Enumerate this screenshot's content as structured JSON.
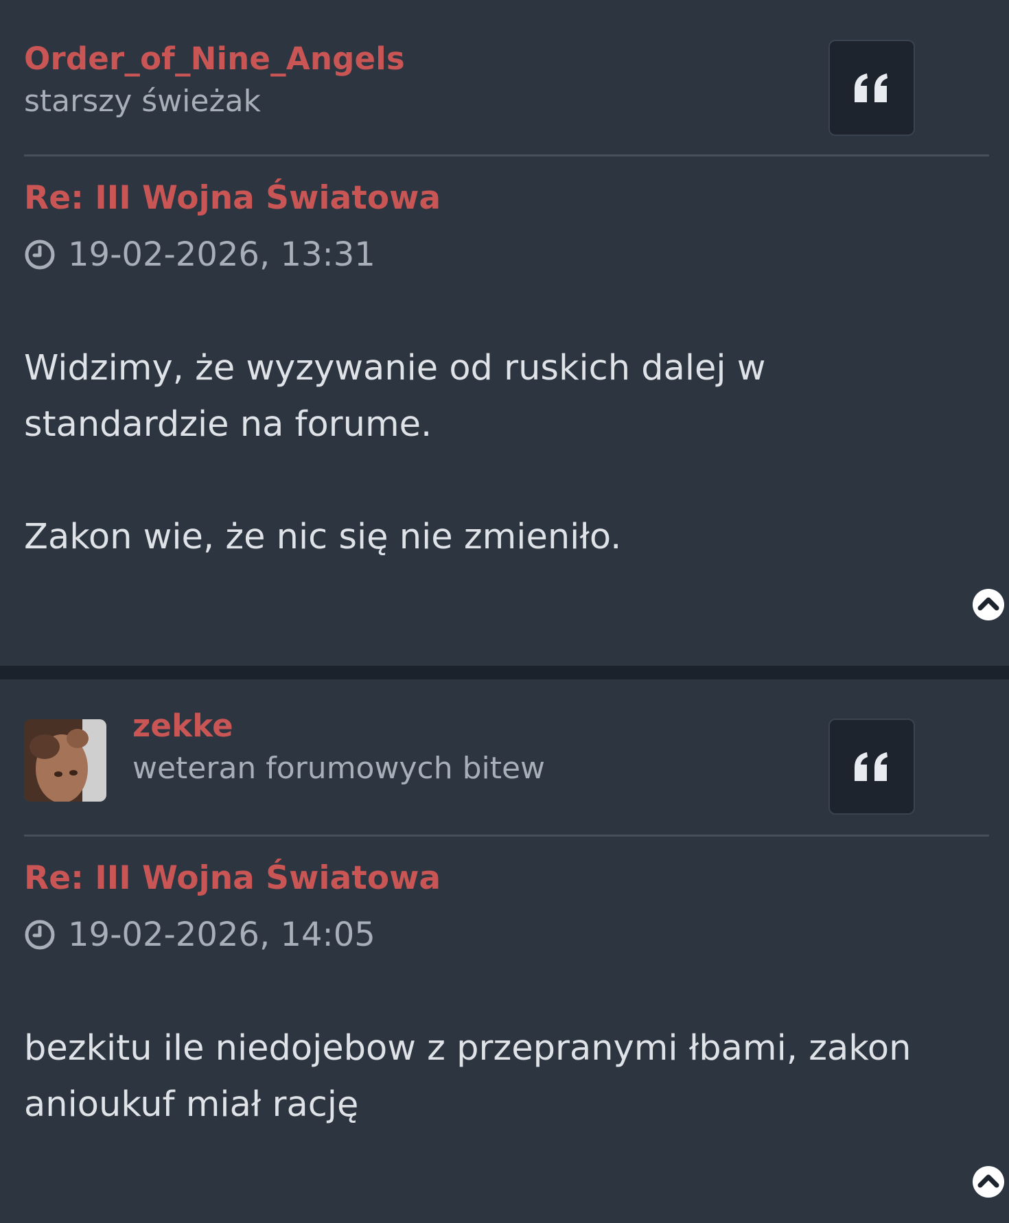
{
  "posts": [
    {
      "author": "Order_of_Nine_Angels",
      "rank": "starszy świeżak",
      "title": "Re: III Wojna Światowa",
      "time": "19-02-2026, 13:31",
      "body": [
        "Widzimy, że wyzywanie od ruskich dalej w standardzie na forume.",
        "Zakon wie, że nic się nie zmieniło."
      ]
    },
    {
      "author": "zekke",
      "rank": "weteran forumowych bitew",
      "title": "Re: III Wojna Światowa",
      "time": "19-02-2026, 14:05",
      "body": [
        "bezkitu ile niedojebow z przepranymi łbami, zakon anioukuf miał rację"
      ]
    }
  ],
  "colors": {
    "accent": "#c95555",
    "post_background": "#2c3540",
    "page_background": "#1b222c",
    "muted_text": "#a9afb8",
    "body_text": "#dfe3e8"
  },
  "icons": {
    "quote": "quote-icon",
    "clock": "clock-icon",
    "back_to_top": "chevron-up-circle-icon"
  }
}
